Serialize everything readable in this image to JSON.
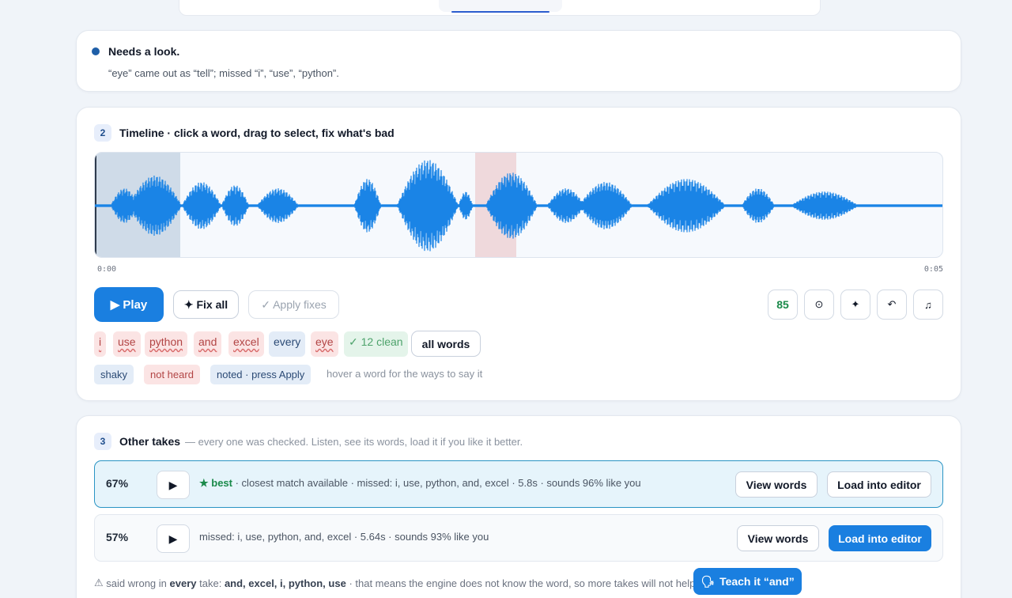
{
  "status": {
    "title": "Needs a look.",
    "detail": "“eye” came out as “tell”; missed “i”, “use”, “python”.",
    "dot_color": "#1f5fa8"
  },
  "timeline": {
    "step": "2",
    "title": "Timeline · click a word, drag to select, fix what's bad",
    "time_start": "0:00",
    "time_end": "0:05",
    "wave_color": "#1a84e6",
    "play_label": "▶ Play",
    "fix_all_label": "✦ Fix all",
    "apply_label": "✓ Apply fixes",
    "score": "85",
    "tools": [
      {
        "icon": "target-icon",
        "glyph": "⊙"
      },
      {
        "icon": "sparkle-icon",
        "glyph": "✦"
      },
      {
        "icon": "undo-icon",
        "glyph": "↶"
      },
      {
        "icon": "music-icon",
        "glyph": "♫"
      }
    ],
    "chips": [
      {
        "label": "i",
        "kind": "bad"
      },
      {
        "label": "use",
        "kind": "bad"
      },
      {
        "label": "python",
        "kind": "bad"
      },
      {
        "label": "and",
        "kind": "bad"
      },
      {
        "label": "excel",
        "kind": "bad"
      },
      {
        "label": "every",
        "kind": "ok"
      },
      {
        "label": "eye",
        "kind": "bad"
      },
      {
        "label": "✓ 12 clean",
        "kind": "clean"
      }
    ],
    "all_words_label": "all words",
    "legend": {
      "shaky": "shaky",
      "not_heard": "not heard",
      "noted": "noted · press Apply",
      "hint": "hover a word for the ways to say it"
    }
  },
  "takes": {
    "step": "3",
    "title": "Other takes",
    "subtitle": "— every one was checked. Listen, see its words, load it if you like it better.",
    "rows": [
      {
        "percent": "67%",
        "best_label": "★ best",
        "info": " · closest match available · missed: i, use, python, and, excel · 5.8s · sounds 96% like you",
        "view_label": "View words",
        "load_label": "Load into editor"
      },
      {
        "percent": "57%",
        "best_label": "",
        "info": "missed: i, use, python, and, excel · 5.64s · sounds 93% like you",
        "view_label": "View words",
        "load_label": "Load into editor"
      }
    ],
    "warning": {
      "icon": "⚠",
      "pre": "said wrong in",
      "every": "every",
      "mid": "take:",
      "words": "and, excel, i, python, use",
      "post": "· that means the engine does not know the word, so more takes will not help."
    },
    "teach_label": "Teach it “and”"
  }
}
